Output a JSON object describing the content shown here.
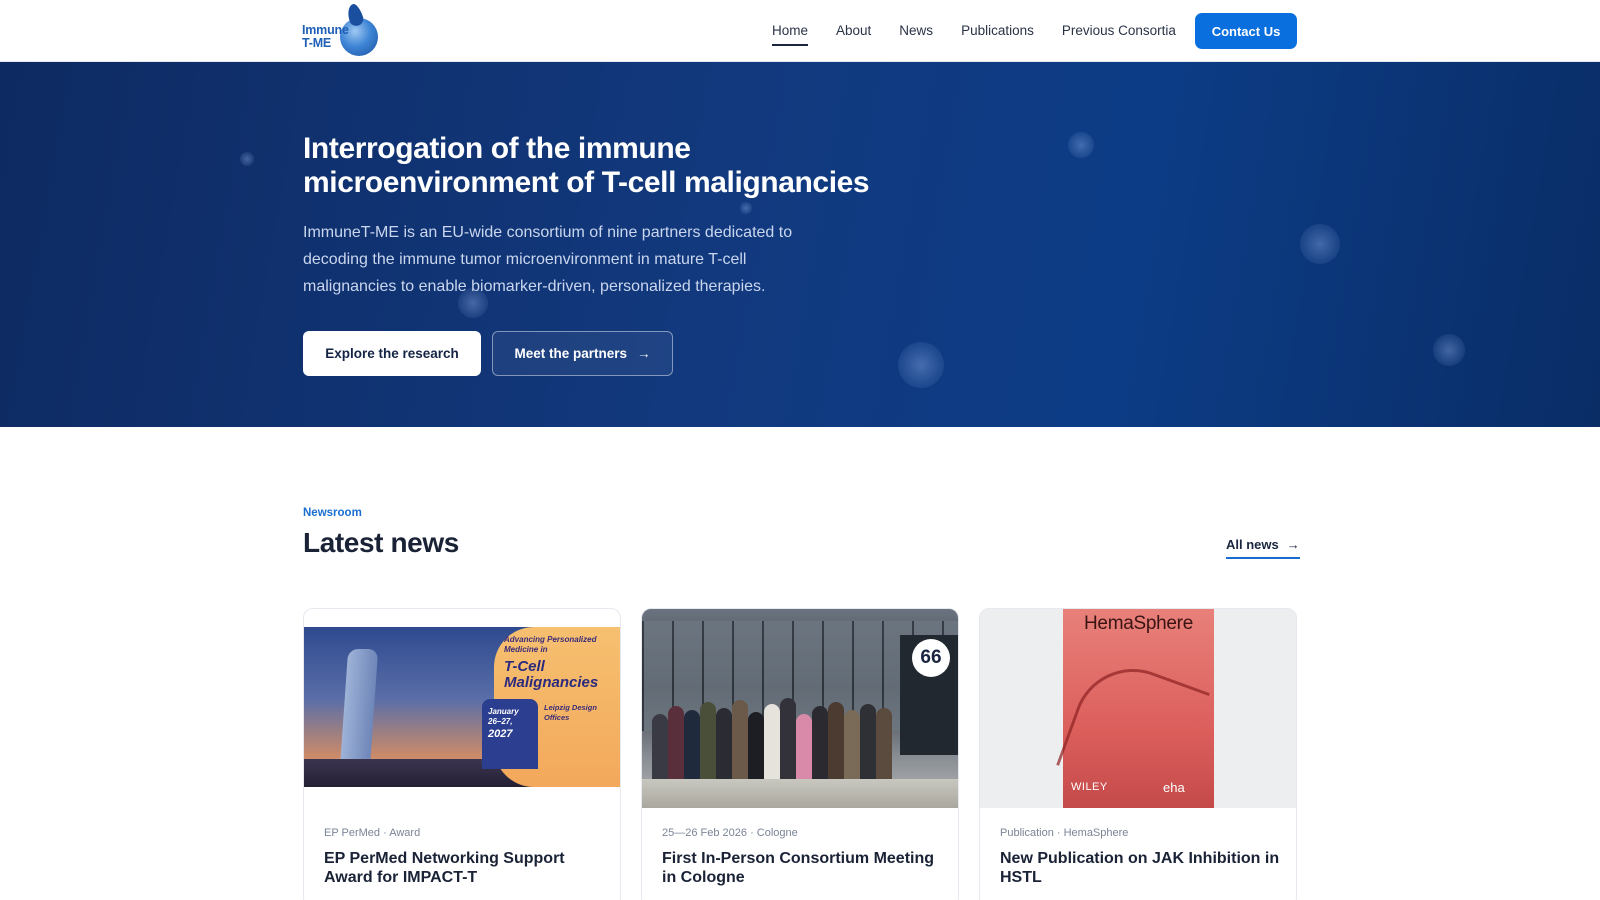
{
  "header": {
    "logo_line1": "Immune",
    "logo_line2": "T-ME",
    "nav": [
      "Home",
      "About",
      "News",
      "Publications",
      "Previous Consortia"
    ],
    "contact_label": "Contact Us"
  },
  "hero": {
    "title": "Interrogation of the immune microenvironment of T-cell malignancies",
    "description": "ImmuneT-ME is an EU-wide consortium of nine partners dedicated to decoding the immune tumor microenvironment in mature T-cell malignancies to enable biomarker-driven, personalized therapies.",
    "primary_cta": "Explore the research",
    "secondary_cta": "Meet the partners",
    "secondary_icon": "arrow-right-icon"
  },
  "news": {
    "kicker": "Newsroom",
    "title": "Latest news",
    "all_label": "All news",
    "cards": [
      {
        "meta": "EP PerMed · Award",
        "title": "EP PerMed Networking Support Award for IMPACT-T",
        "image": {
          "tagline": "Advancing Personalized Medicine in",
          "heading": "T-Cell Malignancies",
          "date_line1": "January",
          "date_line2": "26–27,",
          "year": "2027",
          "location": "Leipzig Design Offices"
        }
      },
      {
        "meta": "25—26 Feb 2026 · Cologne",
        "title": "First In-Person Consortium Meeting in Cologne",
        "image": {
          "badge": "66"
        }
      },
      {
        "meta": "Publication · HemaSphere",
        "title": "New Publication on JAK Inhibition in HSTL",
        "image": {
          "journal": "HemaSphere",
          "publisher": "WILEY",
          "society": "eha"
        }
      }
    ]
  }
}
